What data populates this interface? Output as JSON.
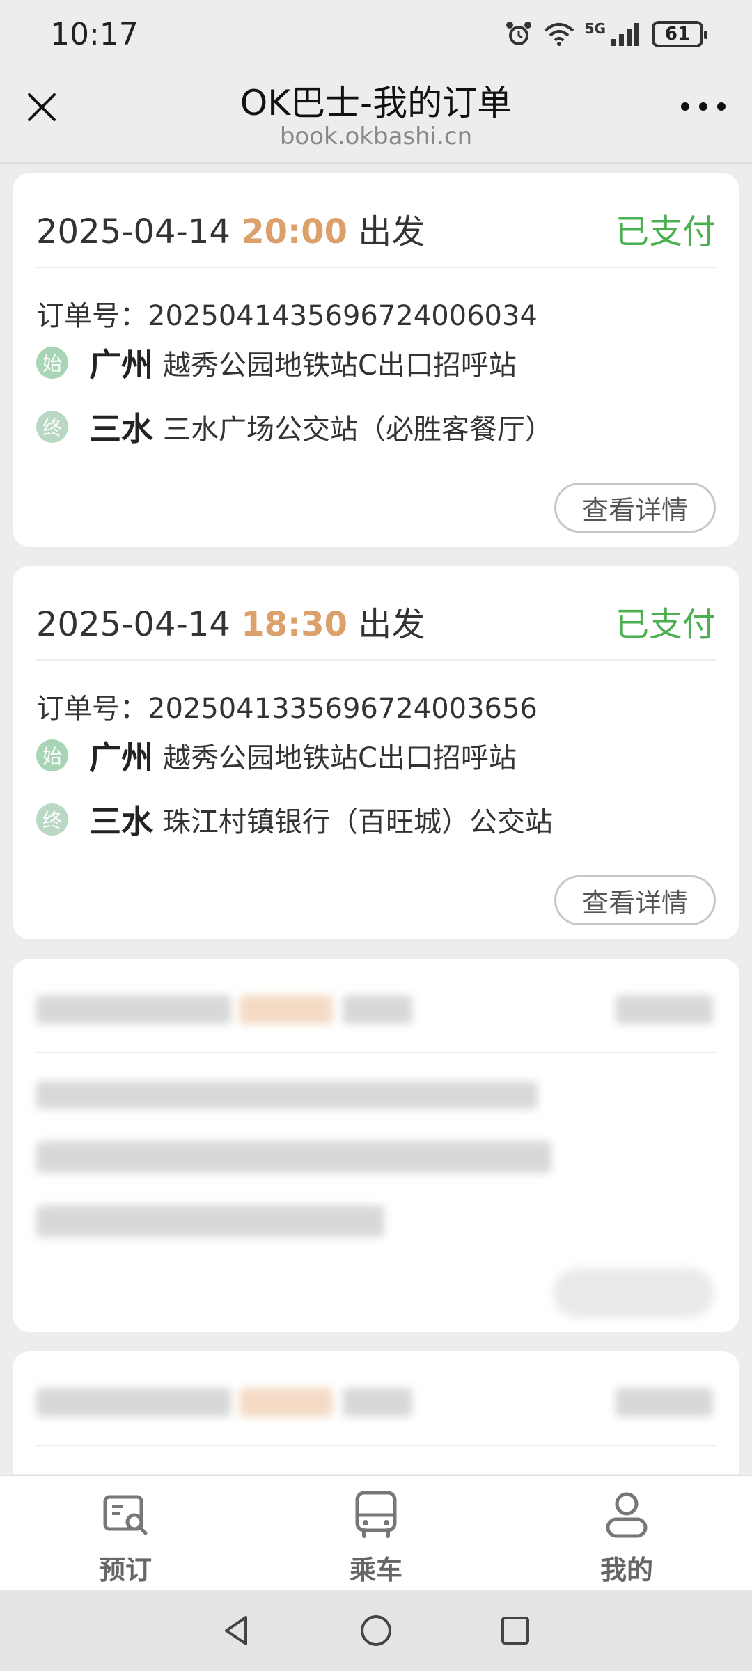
{
  "status_bar": {
    "time": "10:17",
    "network": "5G",
    "battery": "61"
  },
  "nav": {
    "title": "OK巴士-我的订单",
    "subtitle": "book.okbashi.cn"
  },
  "orders": [
    {
      "date": "2025-04-14",
      "time": "20:00",
      "depart_suffix": "出发",
      "status": "已支付",
      "order_label": "订单号：",
      "order_no": "20250414356967240060​34",
      "start_badge": "始",
      "start_city": "广州",
      "start_stop": "越秀公园地铁站C出口招呼站",
      "end_badge": "终",
      "end_city": "三水",
      "end_stop": "三水广场公交站（必胜客餐厅）",
      "detail_button": "查看详情"
    },
    {
      "date": "2025-04-14",
      "time": "18:30",
      "depart_suffix": "出发",
      "status": "已支付",
      "order_label": "订单号：",
      "order_no": "2025041335696724003656",
      "start_badge": "始",
      "start_city": "广州",
      "start_stop": "越秀公园地铁站C出口招呼站",
      "end_badge": "终",
      "end_city": "三水",
      "end_stop": "珠江村镇银行（百旺城）公交站",
      "detail_button": "查看详情"
    }
  ],
  "tabs": [
    {
      "label": "预订",
      "icon": "ticket-search-icon"
    },
    {
      "label": "乘车",
      "icon": "bus-icon"
    },
    {
      "label": "我的",
      "icon": "user-icon"
    }
  ],
  "colors": {
    "paid": "#4caf50",
    "time_accent": "#dca06a",
    "badge": "#a8d5b5"
  }
}
